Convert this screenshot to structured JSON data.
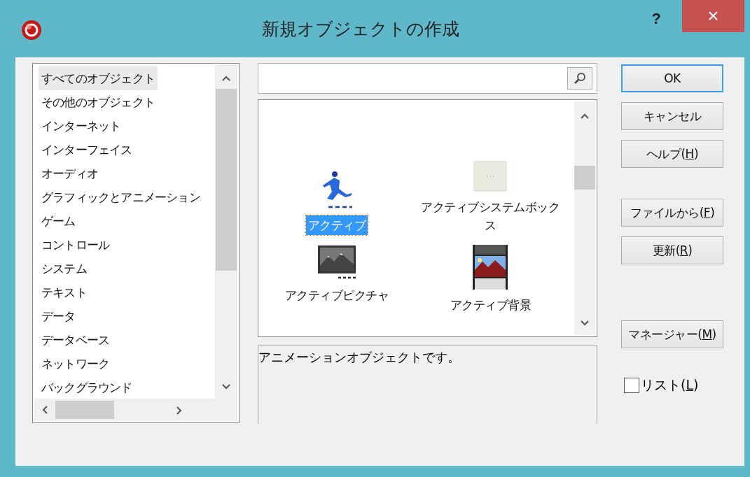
{
  "window": {
    "title": "新規オブジェクトの作成",
    "help": "?",
    "close": "×"
  },
  "categories": [
    {
      "label": "すべてのオブジェクト",
      "selected": true
    },
    {
      "label": "その他のオブジェクト",
      "selected": false
    },
    {
      "label": "インターネット",
      "selected": false
    },
    {
      "label": "インターフェイス",
      "selected": false
    },
    {
      "label": "オーディオ",
      "selected": false
    },
    {
      "label": "グラフィックとアニメーション",
      "selected": false
    },
    {
      "label": "ゲーム",
      "selected": false
    },
    {
      "label": "コントロール",
      "selected": false
    },
    {
      "label": "システム",
      "selected": false
    },
    {
      "label": "テキスト",
      "selected": false
    },
    {
      "label": "データ",
      "selected": false
    },
    {
      "label": "データベース",
      "selected": false
    },
    {
      "label": "ネットワーク",
      "selected": false
    },
    {
      "label": "バックグラウンド",
      "selected": false
    }
  ],
  "objects": [
    {
      "label": "アクティブ",
      "kind": "runner",
      "selected": true
    },
    {
      "label": "アクティブシステムボックス",
      "kind": "box",
      "selected": false
    },
    {
      "label": "アクティブピクチャ",
      "kind": "picture",
      "selected": false
    },
    {
      "label": "アクティブ背景",
      "kind": "film",
      "selected": false
    }
  ],
  "description": "アニメーションオブジェクトです。",
  "buttons": [
    {
      "before": "OK",
      "default": true
    },
    {
      "before": "キャンセル",
      "default": false
    },
    {
      "before": "ヘルプ(",
      "key": "H",
      "after": ")",
      "default": false
    },
    {
      "before": "ファイルから(",
      "key": "F",
      "after": ")",
      "default": false
    },
    {
      "before": "更新(",
      "key": "R",
      "after": ")",
      "default": false
    },
    {
      "before": "マネージャー(",
      "key": "M",
      "after": ")",
      "default": false
    }
  ],
  "list_checkbox": {
    "before": "リスト(",
    "key": "L",
    "after": ")",
    "checked": false
  }
}
